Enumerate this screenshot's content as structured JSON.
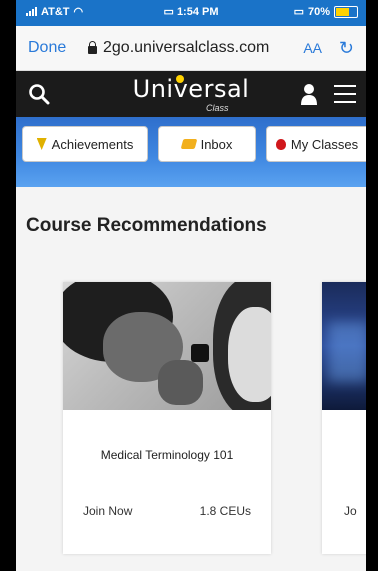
{
  "status_bar": {
    "carrier": "AT&T",
    "time": "1:54 PM",
    "battery": "70%",
    "battery_level": 0.7
  },
  "browser": {
    "done_label": "Done",
    "url": "2go.universalclass.com",
    "text_size_label": "AA"
  },
  "header": {
    "logo_text": "Universal",
    "logo_subtext": "Class"
  },
  "quick_links": [
    {
      "label": "Achievements",
      "icon": "achievement-badge-icon"
    },
    {
      "label": "Inbox",
      "icon": "inbox-folder-icon"
    },
    {
      "label": "My Classes",
      "icon": "apple-icon"
    }
  ],
  "recommendations": {
    "section_title": "Course Recommendations",
    "courses": [
      {
        "title": "Medical Terminology 101",
        "action": "Join Now",
        "ceus": "1.8 CEUs"
      },
      {
        "title": "",
        "action": "Jo",
        "ceus": ""
      }
    ]
  },
  "colors": {
    "status_bar": "#1a73c8",
    "link_blue": "#2a7ad9",
    "header_bg": "#1b1b1b",
    "band_blue": "#3e86e0"
  }
}
